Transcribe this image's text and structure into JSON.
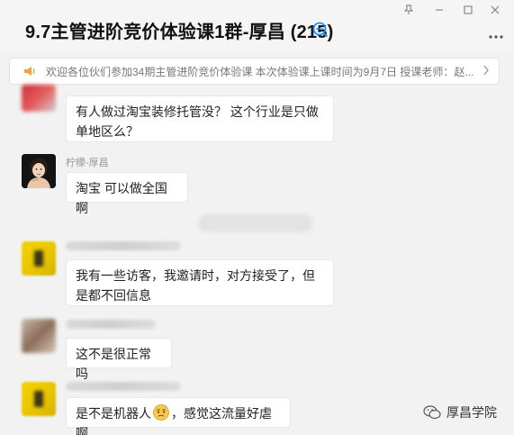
{
  "window": {
    "title": "9.7主管进阶竞价体验课1群-厚昌 (215)",
    "controls": [
      "pin",
      "minimize",
      "maximize",
      "close"
    ],
    "more_icon": "more-icon"
  },
  "notice": {
    "text": "欢迎各位伙们参加34期主管进阶竞价体验课 本次体验课上课时间为9月7日 授课老师：赵..."
  },
  "messages": [
    {
      "sender": "",
      "text": "有人做过淘宝装修托管没？  这个行业是只做单地区么？"
    },
    {
      "sender": "柠檬-厚昌",
      "text": "淘宝 可以做全国啊"
    },
    {
      "sender": "",
      "text": "我有一些访客，我邀请时，对方接受了，但是都不回信息"
    },
    {
      "sender": "",
      "text": "这不是很正常吗"
    },
    {
      "sender": "",
      "text_before": "是不是机器人",
      "text_after": "，感觉这流量好虐啊"
    }
  ],
  "watermark": {
    "text": "厚昌学院"
  },
  "colors": {
    "accent": "#1e90ff",
    "bubble_bg": "#ffffff",
    "chat_bg": "#f2f2f2",
    "notice_icon": "#f2a33a"
  }
}
